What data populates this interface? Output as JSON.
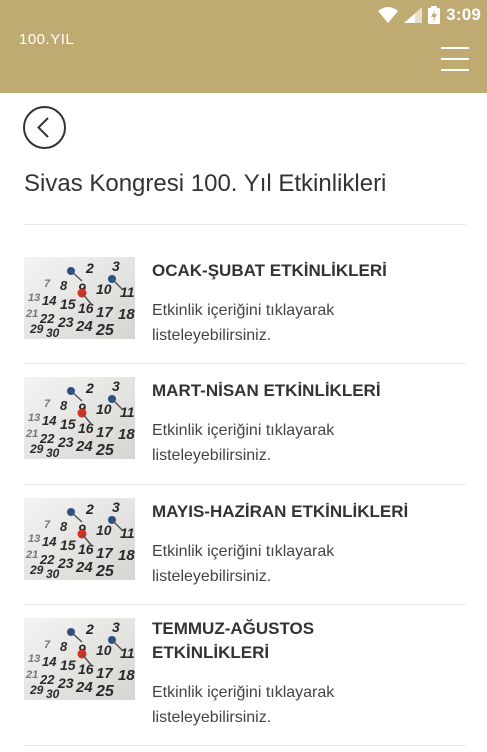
{
  "status_bar": {
    "time": "3:09"
  },
  "header": {
    "logo": "100.YIL"
  },
  "page": {
    "title": "Sivas Kongresi 100. Yıl Etkinlikleri"
  },
  "items": [
    {
      "title": "OCAK-ŞUBAT ETKİNLİKLERİ",
      "desc_line1": "Etkinlik içeriğini tıklayarak",
      "desc_line2": "listeleyebilirsiniz."
    },
    {
      "title": "MART-NİSAN ETKİNLİKLERİ",
      "desc_line1": "Etkinlik içeriğini tıklayarak",
      "desc_line2": "listeleyebilirsiniz."
    },
    {
      "title": "MAYIS-HAZİRAN ETKİNLİKLERİ",
      "desc_line1": "Etkinlik içeriğini tıklayarak",
      "desc_line2": "listeleyebilirsiniz."
    },
    {
      "title_line1": "TEMMUZ-AĞUSTOS",
      "title_line2": "ETKİNLİKLERİ",
      "desc_line1": "Etkinlik içeriğini tıklayarak",
      "desc_line2": "listeleyebilirsiniz."
    }
  ],
  "colors": {
    "header_bg": "#bfab72",
    "text": "#333333"
  }
}
